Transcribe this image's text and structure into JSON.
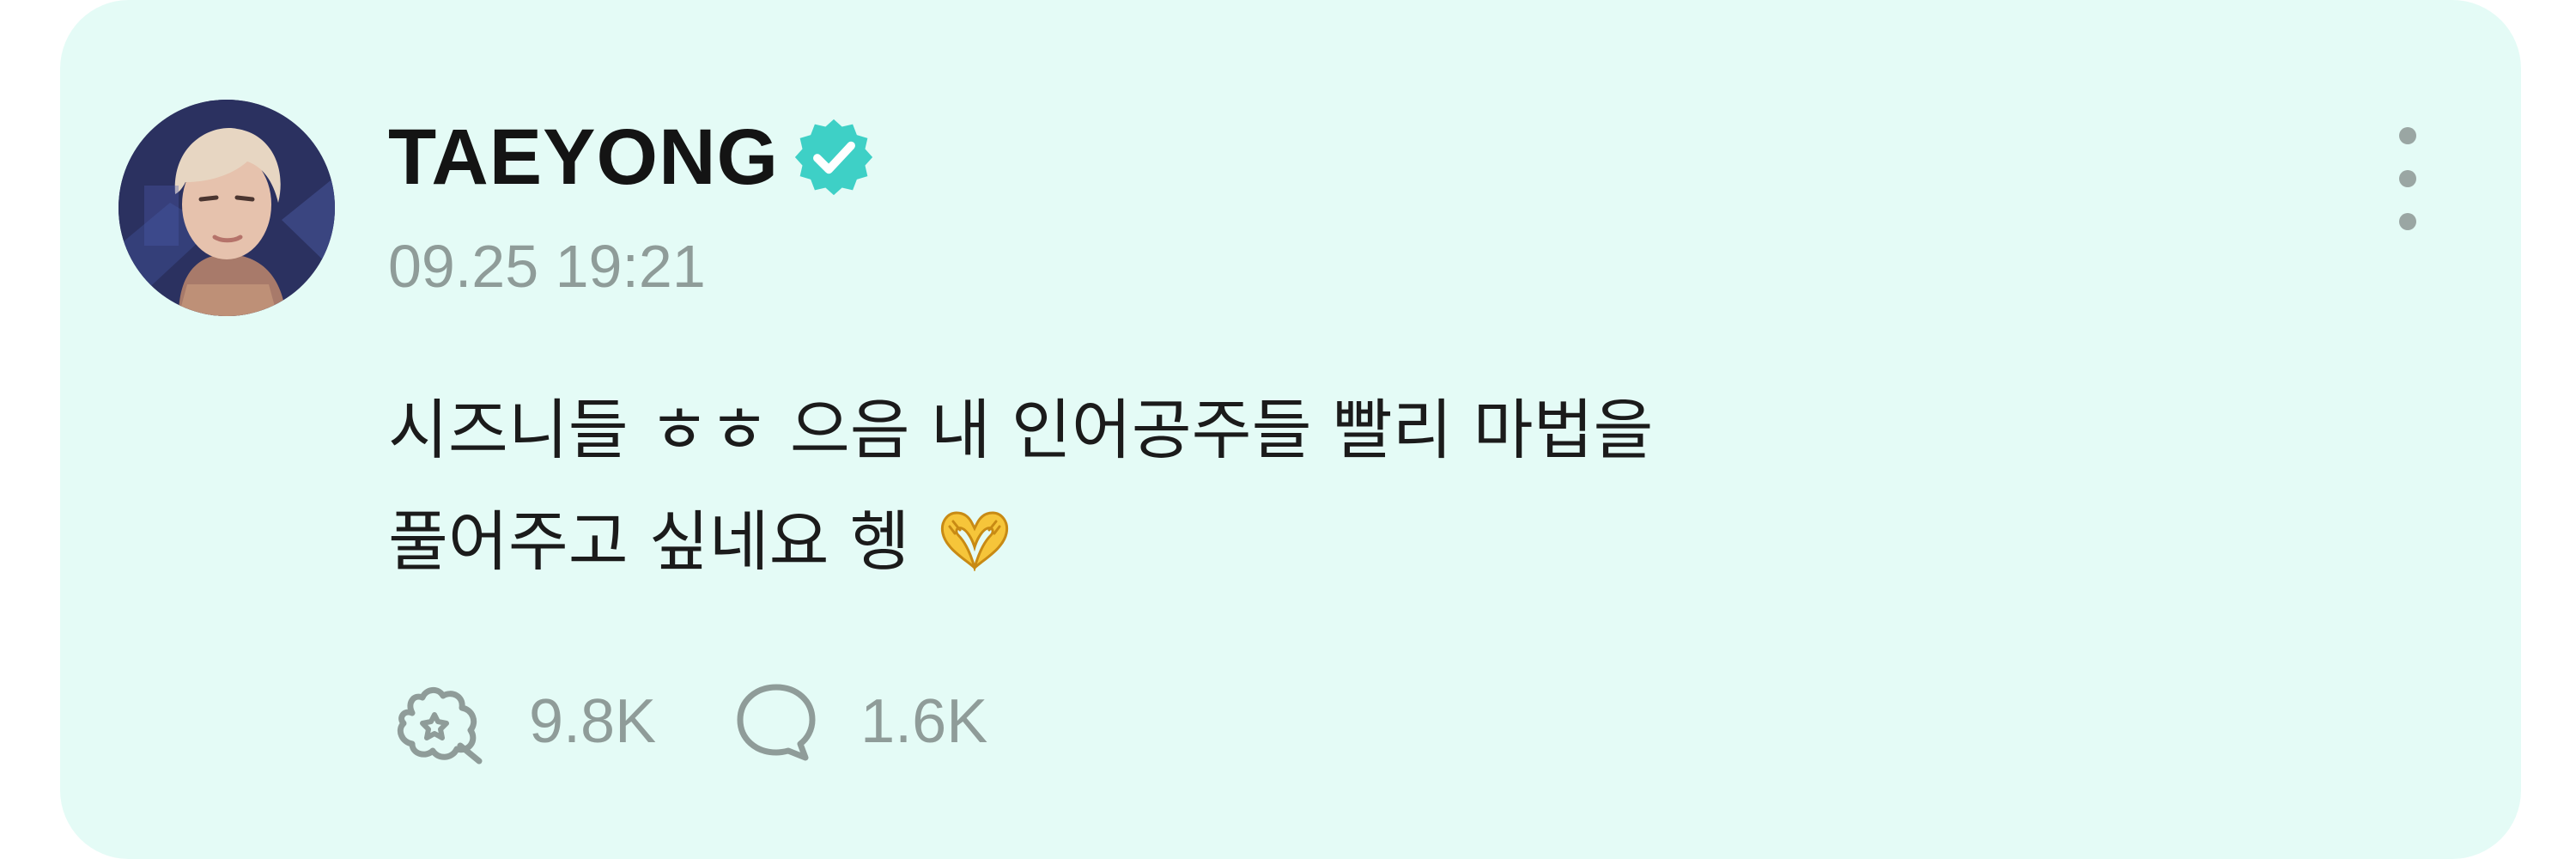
{
  "post": {
    "author": {
      "name": "TAEYONG",
      "verified_icon": "verified-badge-icon",
      "avatar_icon": "profile-avatar"
    },
    "timestamp": "09.25 19:21",
    "body_lines": [
      "시즈니들 ㅎㅎ 으음 내 인어공주들 빨리 마법을",
      "풀어주고 싶네요 헹"
    ],
    "body_emoji": "heart-hands-emoji",
    "more_icon": "more-vertical-icon",
    "actions": {
      "likes": {
        "icon": "like-icon",
        "count": "9.8K"
      },
      "comments": {
        "icon": "comment-icon",
        "count": "1.6K"
      }
    }
  },
  "colors": {
    "card_background": "#e4fbf6",
    "verified": "#3ed0c6",
    "text_primary": "#141414",
    "text_secondary": "#8f9c99"
  }
}
